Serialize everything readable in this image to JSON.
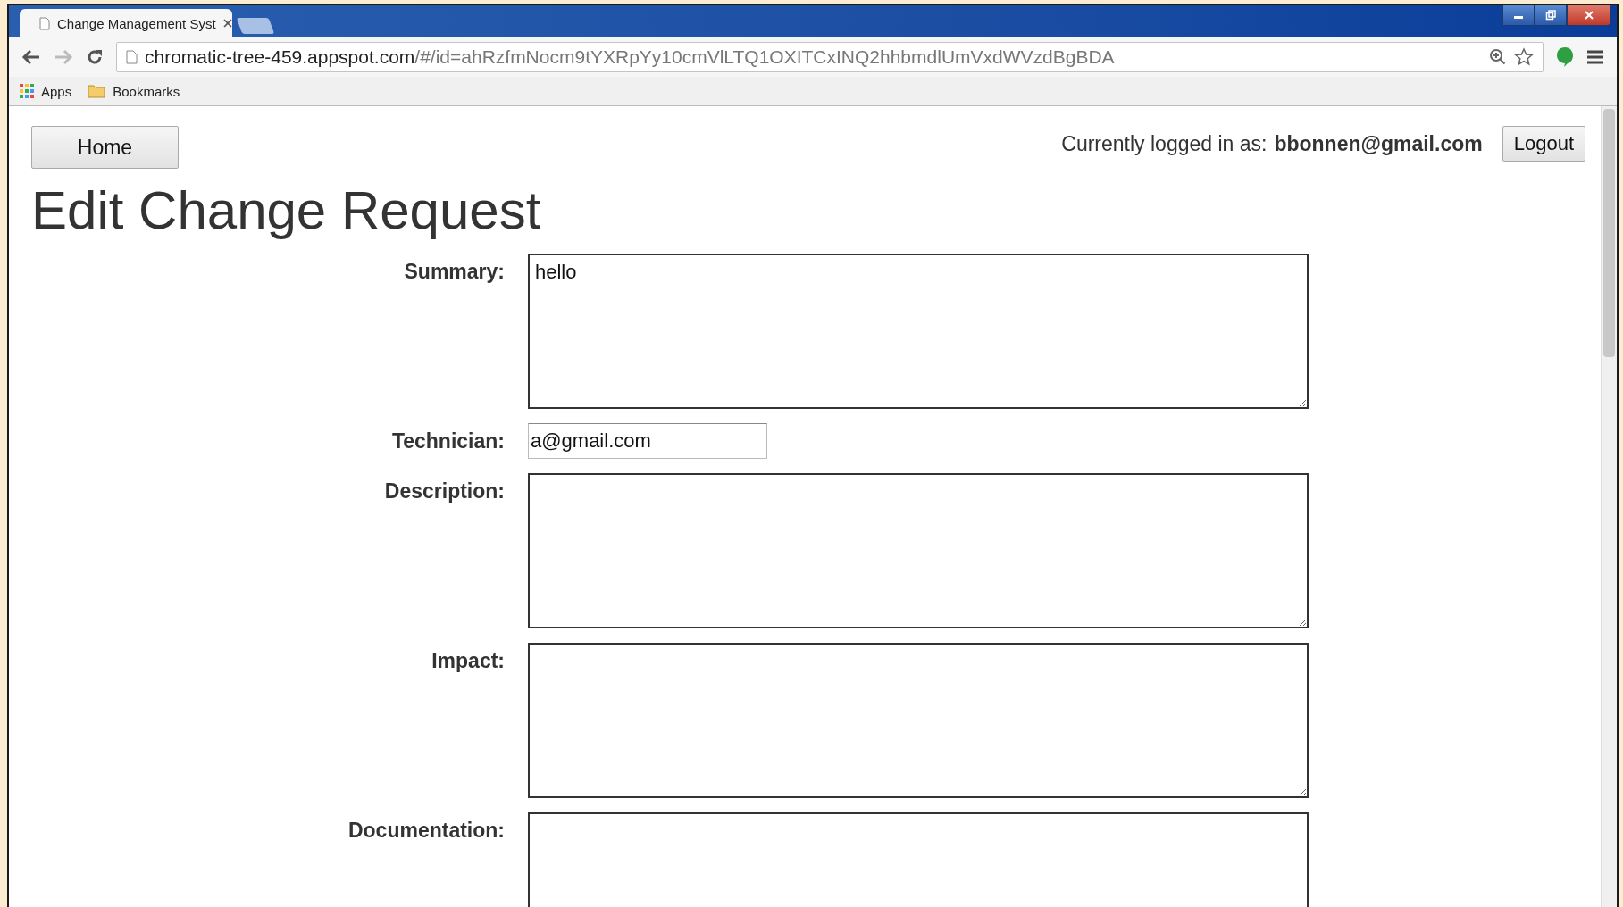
{
  "browser": {
    "tab": {
      "title": "Change Management Syst"
    },
    "url": {
      "host": "chromatic-tree-459.appspot.com",
      "path": "/#/id=ahRzfmNocm9tYXRpYy10cmVlLTQ1OXITCxINQ2hhbmdlUmVxdWVzdBgBDA"
    },
    "bookmarks": [
      "Apps",
      "Bookmarks"
    ]
  },
  "header": {
    "home_button": "Home",
    "login_label": "Currently logged in as:",
    "login_user": "bbonnen@gmail.com",
    "logout_button": "Logout"
  },
  "heading": "Edit Change Request",
  "fields": [
    {
      "label": "Summary:",
      "kind": "textarea",
      "value": "hello"
    },
    {
      "label": "Technician:",
      "kind": "input",
      "value": "a@gmail.com"
    },
    {
      "label": "Description:",
      "kind": "textarea"
    },
    {
      "label": "Impact:",
      "kind": "textarea"
    },
    {
      "label": "Documentation:",
      "kind": "textarea"
    }
  ]
}
